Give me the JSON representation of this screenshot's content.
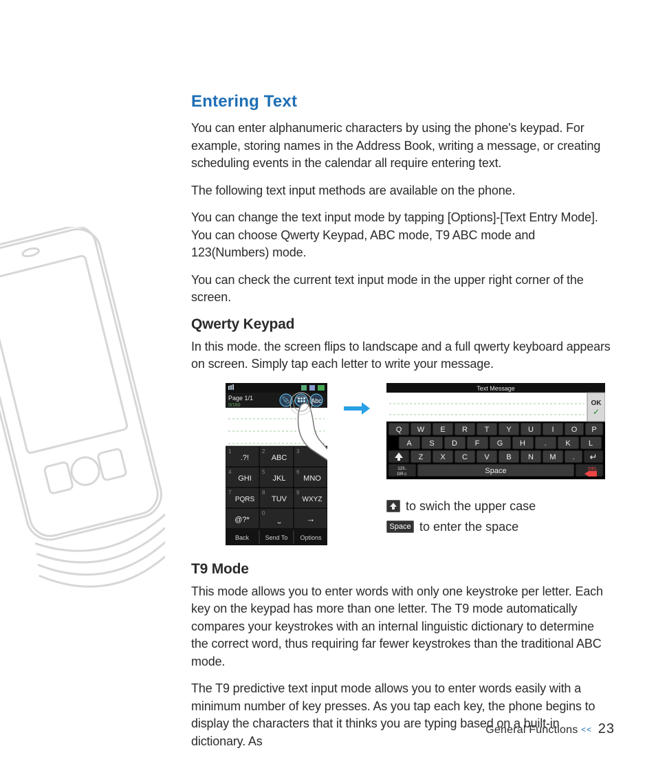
{
  "section_title": "Entering Text",
  "para1": "You can enter alphanumeric characters by using the phone's keypad. For example, storing names in the Address Book, writing a message, or creating scheduling events in the calendar all require entering text.",
  "para2": "The following text input methods are available on the phone.",
  "para3": "You can change the text input mode by tapping [Options]-[Text Entry Mode]. You can choose Qwerty Keypad, ABC mode, T9 ABC mode and 123(Numbers) mode.",
  "para4": "You can check the current text input mode in the upper right corner of the screen.",
  "qwerty_heading": "Qwerty Keypad",
  "qwerty_body": "In this mode. the screen flips to landscape and a full qwerty keyboard appears on screen. Simply tap each letter to write your message.",
  "portrait": {
    "page_label": "Page 1/1",
    "counter": "0/160",
    "mode_badge": "Abc",
    "keys": {
      "1": ".?!",
      "2": "ABC",
      "3": "",
      "4": "GHI",
      "5": "JKL",
      "6": "MNO",
      "7": "PQRS",
      "8": "TUV",
      "9": "WXYZ",
      "star": "@?*",
      "0": "˽",
      "hash": "→"
    },
    "softkeys": {
      "left": "Back",
      "center": "Send To",
      "right": "Options"
    }
  },
  "landscape": {
    "title": "Text Message",
    "ok": "OK",
    "row1": [
      "Q",
      "W",
      "E",
      "R",
      "T",
      "Y",
      "U",
      "I",
      "O",
      "P"
    ],
    "row2": [
      "A",
      "S",
      "D",
      "F",
      "G",
      "H",
      ".",
      "K",
      "L"
    ],
    "row3": [
      "Z",
      "X",
      "C",
      "V",
      "B",
      "N",
      "M",
      "."
    ],
    "shift": "⇧",
    "mode_key": "123..\nGR☺",
    "space": "Space",
    "enter": "↵",
    "del": "DEL"
  },
  "legend": {
    "shift_text": "to swich the upper case",
    "space_label": "Space",
    "space_text": "to enter the space"
  },
  "t9_heading": "T9 Mode",
  "t9_para1": "This mode allows you to enter words with only one keystroke per letter. Each key on the keypad has more than one letter. The T9 mode automatically compares your keystrokes with an internal linguistic dictionary to determine the correct word, thus requiring far fewer keystrokes than the traditional ABC mode.",
  "t9_para2": "The T9 predictive text input mode allows you to enter words easily with a minimum number of key presses. As you tap each key, the phone begins to display the characters that it thinks you are typing based on a built-in dictionary. As",
  "footer": {
    "label": "General Functions",
    "chev": "<<",
    "page": "23"
  }
}
